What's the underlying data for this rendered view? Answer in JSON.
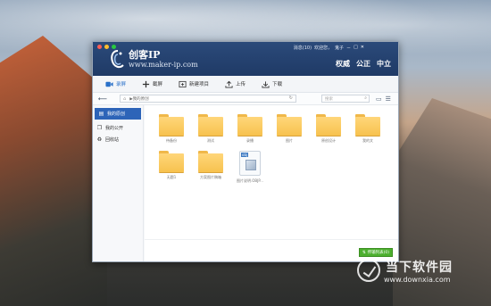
{
  "window": {
    "title_logo": "创客IP",
    "url": "www.maker-ip.com",
    "user_line": [
      "消息(10)",
      "欢迎您，",
      "鬼子"
    ],
    "window_controls": [
      "－",
      "□",
      "✕"
    ],
    "brand_words": [
      "权威",
      "公正",
      "中立"
    ]
  },
  "toolbar": {
    "items": [
      {
        "label": "录屏",
        "icon": "record-icon"
      },
      {
        "label": "截屏",
        "icon": "plus-icon"
      },
      {
        "label": "新建项目",
        "icon": "new-folder-icon"
      },
      {
        "label": "上传",
        "icon": "upload-icon"
      },
      {
        "label": "下载",
        "icon": "download-icon"
      }
    ]
  },
  "pathbar": {
    "path": "▶我的原创",
    "search_placeholder": "搜索"
  },
  "sidebar": {
    "items": [
      {
        "label": "我的原创",
        "icon": "folder-icon"
      },
      {
        "label": "我的公开",
        "icon": "file-icon"
      },
      {
        "label": "回收站",
        "icon": "trash-icon"
      }
    ]
  },
  "files": [
    {
      "name": "待备份",
      "type": "folder"
    },
    {
      "name": "测试",
      "type": "folder"
    },
    {
      "name": "录播",
      "type": "folder"
    },
    {
      "name": "图片",
      "type": "folder"
    },
    {
      "name": "原创设计",
      "type": "folder"
    },
    {
      "name": "我的文",
      "type": "folder"
    },
    {
      "name": "无题1",
      "type": "folder"
    },
    {
      "name": "方案图片稿箱",
      "type": "folder"
    },
    {
      "name": "图片说明.OBJP...",
      "type": "obj"
    }
  ],
  "footer": {
    "transfer_label": "传输列表(0)"
  },
  "watermark": {
    "title": "当下软件园",
    "url": "www.downxia.com"
  },
  "colors": {
    "titlebar": "#1f3a66",
    "accent": "#2d64b8",
    "folder": "#f7c24e",
    "transfer": "#4caf2e"
  }
}
